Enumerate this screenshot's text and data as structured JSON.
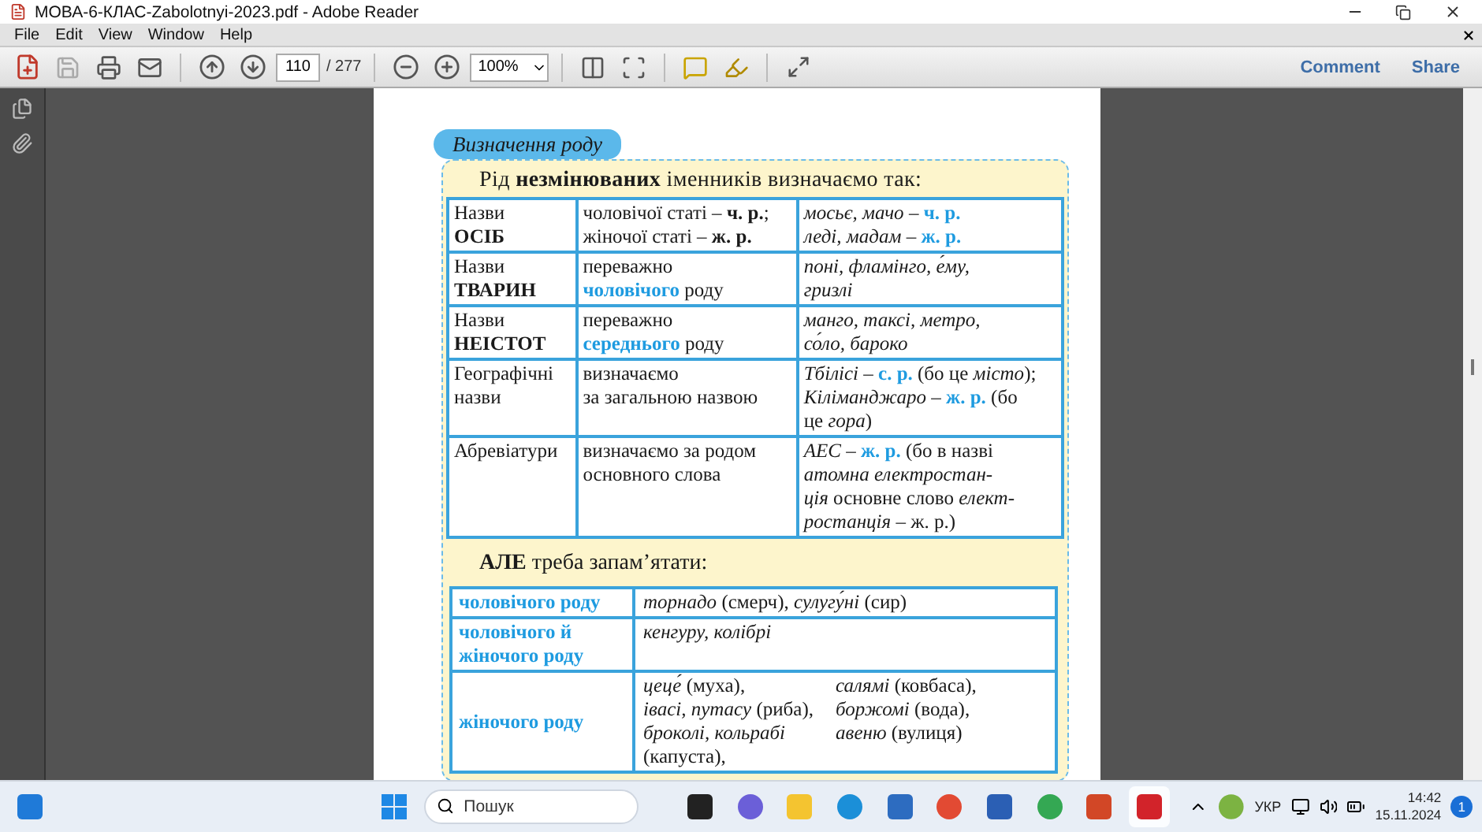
{
  "window": {
    "title": "МОВА-6-КЛАС-Zabolotnyi-2023.pdf - Adobe Reader"
  },
  "menu": [
    "File",
    "Edit",
    "View",
    "Window",
    "Help"
  ],
  "toolbar": {
    "page": "110",
    "page_count": "/ 277",
    "zoom": "100%",
    "actions": [
      "Comment",
      "Share"
    ]
  },
  "document": {
    "heading": "Визначення роду",
    "intro": "Рід **незмінюваних** іменників визначаємо так:",
    "table": [
      {
        "cells": [
          [
            [
              {
                "t": "Назви",
                "accent": false
              }
            ],
            [
              {
                "t": "**ОСІБ**",
                "accent": false
              }
            ]
          ],
          [
            [
              {
                "t": "чоловічої статі – **ч. р.**;",
                "accent": false
              }
            ],
            [
              {
                "t": "жіночої статі – **ж. р.**",
                "accent": false
              }
            ]
          ],
          [
            [
              {
                "t": "*мосьє, мачо* – ",
                "accent": false
              },
              {
                "t": "**ч. р.**",
                "accent": true
              }
            ],
            [
              {
                "t": "*леді, мадам* – ",
                "accent": false
              },
              {
                "t": "**ж. р.**",
                "accent": true
              }
            ]
          ]
        ]
      },
      {
        "cells": [
          [
            [
              {
                "t": "Назви",
                "accent": false
              }
            ],
            [
              {
                "t": "**ТВАРИН**",
                "accent": false
              }
            ]
          ],
          [
            [
              {
                "t": "переважно",
                "accent": false
              }
            ],
            [
              {
                "t": "**чоловічого**",
                "accent": true
              },
              {
                "t": " роду",
                "accent": false
              }
            ]
          ],
          [
            [
              {
                "t": "*поні, фламінго, е́му,*",
                "accent": false
              }
            ],
            [
              {
                "t": "*гризлі*",
                "accent": false
              }
            ]
          ]
        ]
      },
      {
        "cells": [
          [
            [
              {
                "t": "Назви",
                "accent": false
              }
            ],
            [
              {
                "t": "**НЕІСТОТ**",
                "accent": false
              }
            ]
          ],
          [
            [
              {
                "t": "переважно",
                "accent": false
              }
            ],
            [
              {
                "t": "**середнього**",
                "accent": true
              },
              {
                "t": " роду",
                "accent": false
              }
            ]
          ],
          [
            [
              {
                "t": "*манго, таксі, метро,*",
                "accent": false
              }
            ],
            [
              {
                "t": "*со́ло, бароко*",
                "accent": false
              }
            ]
          ]
        ]
      },
      {
        "cells": [
          [
            [
              {
                "t": "Географічні",
                "accent": false
              }
            ],
            [
              {
                "t": "назви",
                "accent": false
              }
            ]
          ],
          [
            [
              {
                "t": "визначаємо",
                "accent": false
              }
            ],
            [
              {
                "t": "за загальною назвою",
                "accent": false
              }
            ]
          ],
          [
            [
              {
                "t": "*Тбілісі* – ",
                "accent": false
              },
              {
                "t": "**с. р.**",
                "accent": true
              },
              {
                "t": " (бо це *місто*);",
                "accent": false
              }
            ],
            [
              {
                "t": "*Кіліманджаро* – ",
                "accent": false
              },
              {
                "t": "**ж. р.**",
                "accent": true
              },
              {
                "t": " (бо",
                "accent": false
              }
            ],
            [
              {
                "t": "це *гора*)",
                "accent": false
              }
            ]
          ]
        ]
      },
      {
        "cells": [
          [
            [
              {
                "t": "Абревіатури",
                "accent": false
              }
            ]
          ],
          [
            [
              {
                "t": "визначаємо за родом",
                "accent": false
              }
            ],
            [
              {
                "t": "основного слова",
                "accent": false
              }
            ]
          ],
          [
            [
              {
                "t": "*АЕС* – ",
                "accent": false
              },
              {
                "t": "**ж. р.**",
                "accent": true
              },
              {
                "t": " (бо в назві",
                "accent": false
              }
            ],
            [
              {
                "t": "*атомна електростан-*",
                "accent": false
              }
            ],
            [
              {
                "t": "*ція* основне слово *елект-*",
                "accent": false
              }
            ],
            [
              {
                "t": "*ростанція* – ж. р.)",
                "accent": false
              }
            ]
          ]
        ]
      }
    ],
    "note": "**АЛЕ** треба запам’ятати:",
    "exceptions": [
      {
        "category": [
          "чоловічого роду"
        ],
        "examples": [
          [
            "*торнадо* (смерч), *сулугу́ні* (сир)"
          ]
        ]
      },
      {
        "category": [
          "чоловічого й",
          "жіночого роду"
        ],
        "examples": [
          [
            "*кенгуру, колібрі*"
          ]
        ]
      },
      {
        "category": [
          "жіночого роду"
        ],
        "examples": [
          [
            "*цеце́* (муха),",
            "*івасі, путасу* (риба),",
            "*броколі, кольрабі*",
            "(капуста),"
          ],
          [
            "*салямі* (ковбаса),",
            "*боржомі* (вода),",
            "*авеню* (вулиця)"
          ]
        ]
      }
    ]
  },
  "taskbar": {
    "search": {
      "placeholder": "Пошук"
    },
    "language": "УКР",
    "time": "14:42",
    "date": "15.11.2024",
    "badge": "1"
  }
}
